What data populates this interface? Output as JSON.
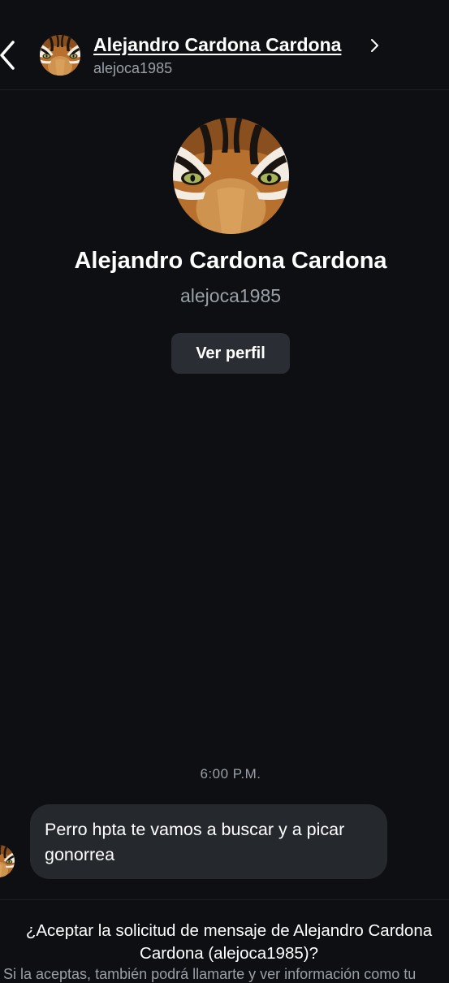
{
  "header": {
    "name": "Alejandro Cardona Cardona",
    "username": "alejoca1985",
    "back_icon": "chevron-left-icon",
    "chevron_icon": "chevron-right-icon"
  },
  "profile": {
    "name": "Alejandro Cardona Cardona",
    "username": "alejoca1985",
    "view_profile_label": "Ver perfil"
  },
  "conversation": {
    "timestamp": "6:00 P.M.",
    "messages": [
      {
        "text": "Perro hpta te vamos a buscar y a picar gonorrea"
      }
    ]
  },
  "request": {
    "question": "¿Aceptar la solicitud de mensaje de Alejandro Cardona Cardona (alejoca1985)?",
    "info": "Si la aceptas, también podrá llamarte y ver información como tu"
  },
  "colors": {
    "background": "#0d0f12",
    "bubble": "#25282d",
    "button": "#2a2d33",
    "secondary_text": "#9aa0a8"
  }
}
